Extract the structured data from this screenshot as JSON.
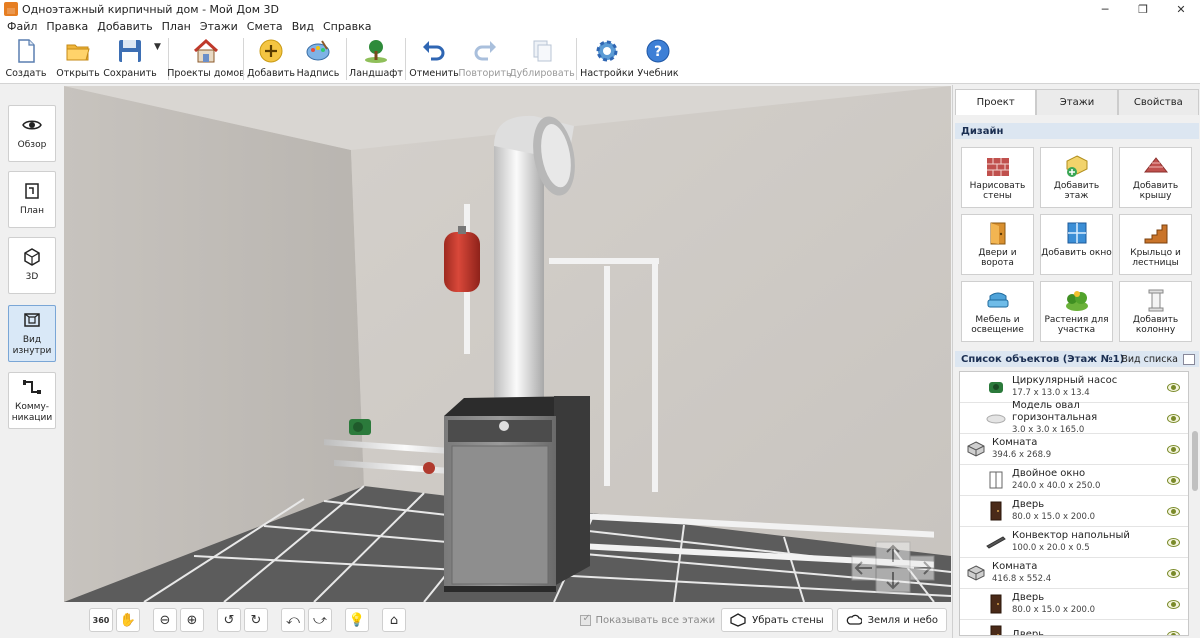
{
  "window": {
    "title": "Одноэтажный кирпичный дом - Мой Дом 3D",
    "minimize": "─",
    "maximize": "❐",
    "close": "✕"
  },
  "menu": [
    "Файл",
    "Правка",
    "Добавить",
    "План",
    "Этажи",
    "Смета",
    "Вид",
    "Справка"
  ],
  "toolbar": {
    "create": "Создать",
    "open": "Открыть",
    "save": "Сохранить",
    "save_arrow": "▼",
    "house_projects": "Проекты домов",
    "add": "Добавить",
    "caption": "Надпись",
    "landscape": "Ландшафт",
    "undo": "Отменить",
    "redo": "Повторить",
    "duplicate": "Дублировать",
    "settings": "Настройки",
    "tutorial": "Учебник"
  },
  "left_views": [
    "Обзор",
    "План",
    "3D",
    "Вид изнутри",
    "Комму-никации"
  ],
  "bottom": {
    "show_all_floors": "Показывать все этажи",
    "remove_walls": "Убрать стены",
    "earth_sky": "Земля и небо"
  },
  "right": {
    "tabs": [
      "Проект",
      "Этажи",
      "Свойства"
    ],
    "design_header": "Дизайн",
    "design_buttons": [
      "Нарисовать стены",
      "Добавить этаж",
      "Добавить крышу",
      "Двери и ворота",
      "Добавить окно",
      "Крыльцо и лестницы",
      "Мебель и освещение",
      "Растения для участка",
      "Добавить колонну"
    ],
    "list_header": "Список объектов (Этаж №1)",
    "list_view": "Вид списка",
    "objects": [
      {
        "name": "Циркулярный насос",
        "dims": "17.7 x 13.0 x 13.4",
        "indent": 1,
        "icon": "pump-icon"
      },
      {
        "name": "Модель овал горизонтальная",
        "dims": "3.0 x 3.0 x 165.0",
        "indent": 1,
        "icon": "oval-model-icon"
      },
      {
        "name": "Комната",
        "dims": "394.6 x 268.9",
        "indent": 0,
        "icon": "room-icon"
      },
      {
        "name": "Двойное окно",
        "dims": "240.0 x 40.0 x 250.0",
        "indent": 1,
        "icon": "window-icon"
      },
      {
        "name": "Дверь",
        "dims": "80.0 x 15.0 x 200.0",
        "indent": 1,
        "icon": "door-icon"
      },
      {
        "name": "Конвектор напольный",
        "dims": "100.0 x 20.0 x 0.5",
        "indent": 1,
        "icon": "convector-icon"
      },
      {
        "name": "Комната",
        "dims": "416.8 x 552.4",
        "indent": 0,
        "icon": "room-icon"
      },
      {
        "name": "Дверь",
        "dims": "80.0 x 15.0 x 200.0",
        "indent": 1,
        "icon": "door-icon"
      },
      {
        "name": "Дверь",
        "dims": "",
        "indent": 1,
        "icon": "door-icon"
      }
    ]
  }
}
